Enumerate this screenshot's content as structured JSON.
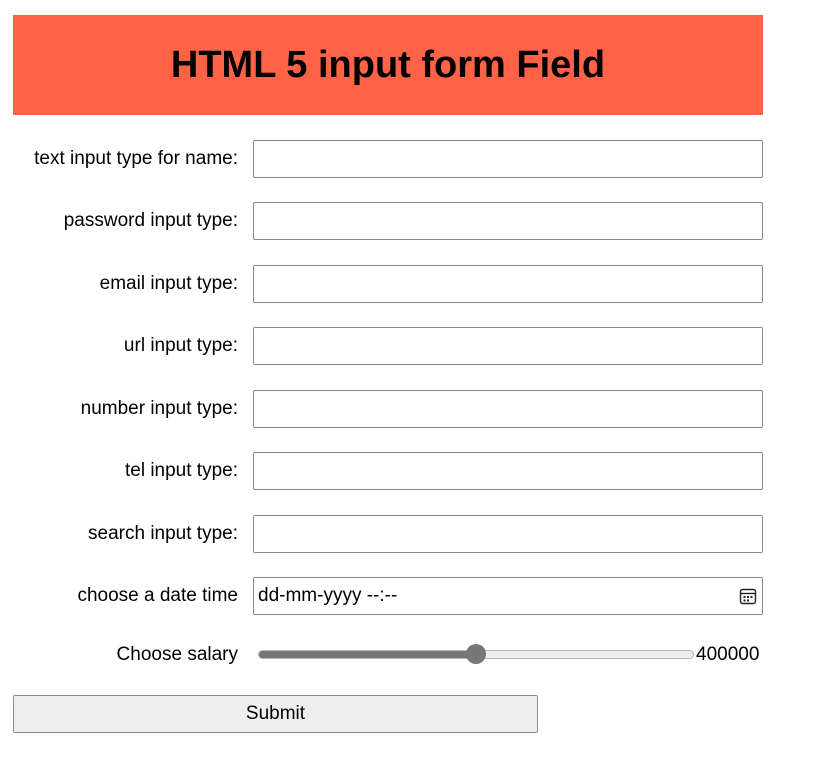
{
  "header": {
    "title": "HTML 5 input form Field",
    "background": "#ff6347"
  },
  "form": {
    "fields": [
      {
        "label": "text input type for name:",
        "type": "text",
        "value": ""
      },
      {
        "label": "password input type:",
        "type": "password",
        "value": ""
      },
      {
        "label": "email input type:",
        "type": "email",
        "value": ""
      },
      {
        "label": "url input type:",
        "type": "url",
        "value": ""
      },
      {
        "label": "number input type:",
        "type": "number",
        "value": ""
      },
      {
        "label": "tel input type:",
        "type": "tel",
        "value": ""
      },
      {
        "label": "search input type:",
        "type": "search",
        "value": ""
      }
    ],
    "datetime": {
      "label": "choose a date time",
      "placeholder": "dd-mm-yyyy --:--",
      "icon": "calendar-icon"
    },
    "salary": {
      "label": "Choose salary",
      "value_text": "400000",
      "level_fraction": 0.5,
      "accent": "#777777"
    },
    "submit_label": "Submit"
  }
}
